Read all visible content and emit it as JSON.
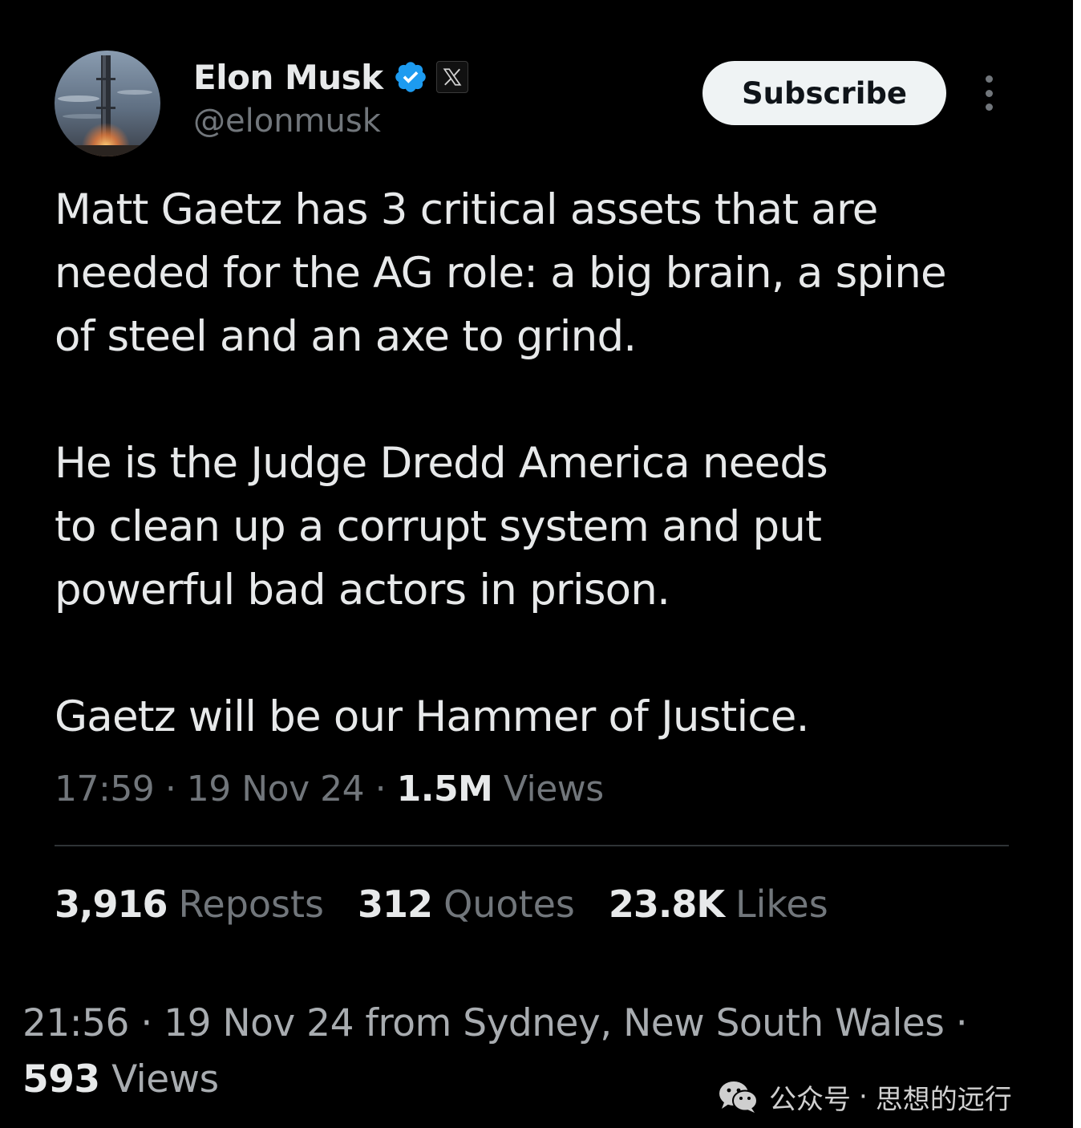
{
  "colors": {
    "background": "#000000",
    "primary_text": "#e7e9ea",
    "secondary_text": "#71767b",
    "verified_blue": "#1d9bf0",
    "subscribe_bg": "#eff3f4"
  },
  "author": {
    "display_name": "Elon Musk",
    "handle": "@elonmusk",
    "verified_icon": "verified-badge-icon",
    "affiliation_icon": "x-logo-icon"
  },
  "header": {
    "subscribe_label": "Subscribe",
    "more_icon": "more-options-icon"
  },
  "tweet": {
    "paragraphs": [
      [
        "Matt Gaetz has 3 critical assets that are",
        "needed for the AG role: a big brain, a spine",
        "of steel and an axe to grind."
      ],
      [
        "He is the Judge Dredd America needs",
        "to clean up a corrupt system and put",
        "powerful bad actors in prison."
      ],
      [
        "Gaetz will be our Hammer of Justice."
      ]
    ],
    "time": "17:59",
    "date": "19 Nov 24",
    "views_count": "1.5M",
    "views_label": "Views"
  },
  "stats": {
    "reposts": {
      "count": "3,916",
      "label": "Reposts"
    },
    "quotes": {
      "count": "312",
      "label": "Quotes"
    },
    "likes": {
      "count": "23.8K",
      "label": "Likes"
    }
  },
  "footer": {
    "line1": "21:56 · 19 Nov 24 from Sydney, New South Wales ·",
    "views_count": "593",
    "views_label": "Views"
  },
  "watermark": {
    "icon": "wechat-icon",
    "account_type": "公众号",
    "separator": "·",
    "account_name": "思想的远行"
  }
}
